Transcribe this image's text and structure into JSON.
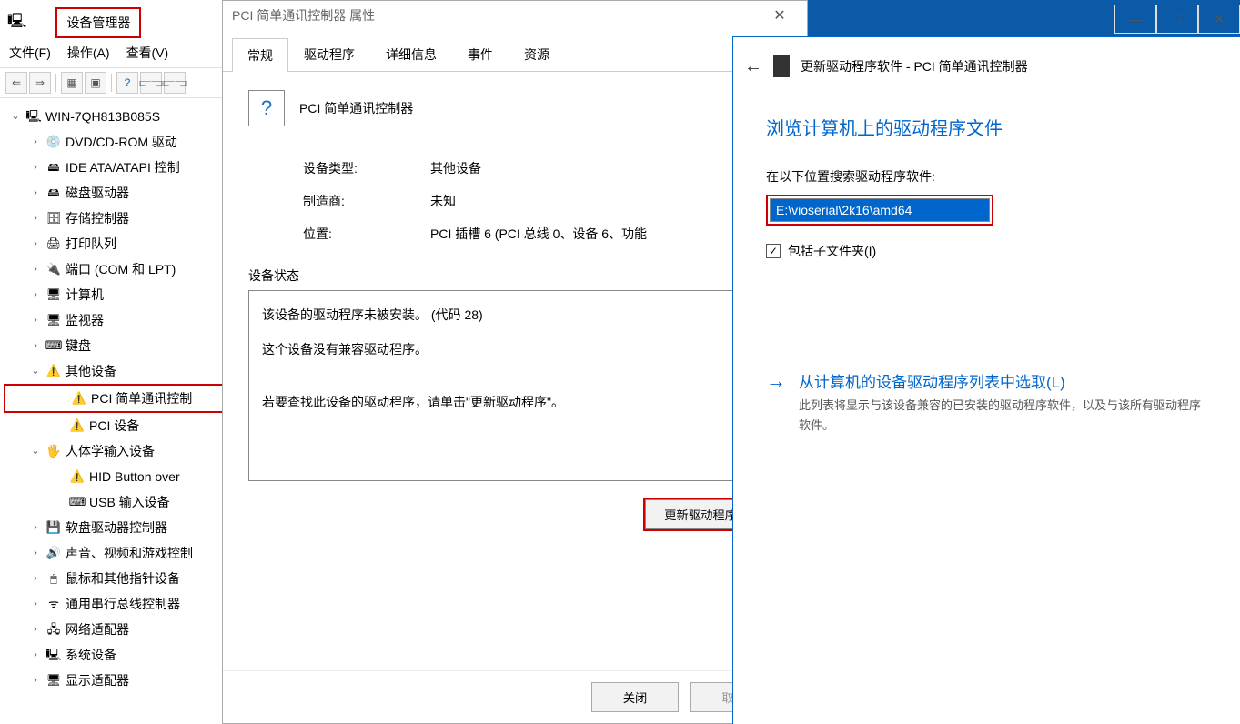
{
  "devmgr": {
    "title": "设备管理器",
    "menus": {
      "file": "文件(F)",
      "action": "操作(A)",
      "view": "查看(V)"
    },
    "root": "WIN-7QH813B085S",
    "nodes": [
      {
        "label": "DVD/CD-ROM 驱动",
        "icon": "💿"
      },
      {
        "label": "IDE ATA/ATAPI 控制",
        "icon": "🖴"
      },
      {
        "label": "磁盘驱动器",
        "icon": "🖴"
      },
      {
        "label": "存储控制器",
        "icon": "🗄"
      },
      {
        "label": "打印队列",
        "icon": "🖨"
      },
      {
        "label": "端口 (COM 和 LPT)",
        "icon": "🔌"
      },
      {
        "label": "计算机",
        "icon": "🖥"
      },
      {
        "label": "监视器",
        "icon": "🖥"
      },
      {
        "label": "键盘",
        "icon": "⌨"
      }
    ],
    "other_devices_label": "其他设备",
    "other_devices": [
      {
        "label": "PCI 简单通讯控制",
        "warn": true,
        "hl": true
      },
      {
        "label": "PCI 设备",
        "warn": true
      }
    ],
    "hid_label": "人体学输入设备",
    "hid": [
      {
        "label": "HID Button over",
        "warn": true
      },
      {
        "label": "USB 输入设备"
      }
    ],
    "rest": [
      {
        "label": "软盘驱动器控制器",
        "icon": "💾"
      },
      {
        "label": "声音、视频和游戏控制",
        "icon": "🔊"
      },
      {
        "label": "鼠标和其他指针设备",
        "icon": "🖱"
      },
      {
        "label": "通用串行总线控制器",
        "icon": "ᯤ"
      },
      {
        "label": "网络适配器",
        "icon": "🖧"
      },
      {
        "label": "系统设备",
        "icon": "🖳"
      },
      {
        "label": "显示适配器",
        "icon": "🖥"
      }
    ]
  },
  "props": {
    "title": "PCI 简单通讯控制器 属性",
    "tabs": {
      "general": "常规",
      "driver": "驱动程序",
      "details": "详细信息",
      "events": "事件",
      "resources": "资源"
    },
    "device_name": "PCI 简单通讯控制器",
    "rows": {
      "type_label": "设备类型:",
      "type_value": "其他设备",
      "mfr_label": "制造商:",
      "mfr_value": "未知",
      "loc_label": "位置:",
      "loc_value": "PCI 插槽 6 (PCI 总线 0、设备 6、功能"
    },
    "status_legend": "设备状态",
    "status_lines": [
      "该设备的驱动程序未被安装。 (代码 28)",
      "这个设备没有兼容驱动程序。",
      "若要查找此设备的驱动程序，请单击\"更新驱动程序\"。"
    ],
    "update_btn": "更新驱动程序(U)..",
    "close_btn": "关闭",
    "cancel_btn": "取消"
  },
  "wizard": {
    "title": "更新驱动程序软件 - PCI 简单通讯控制器",
    "heading": "浏览计算机上的驱动程序文件",
    "search_label": "在以下位置搜索驱动程序软件:",
    "path_value": "E:\\vioserial\\2k16\\amd64",
    "include_sub": "包括子文件夹(I)",
    "option_title": "从计算机的设备驱动程序列表中选取(L)",
    "option_desc": "此列表将显示与该设备兼容的已安装的驱动程序软件，以及与该所有驱动程序软件。"
  }
}
